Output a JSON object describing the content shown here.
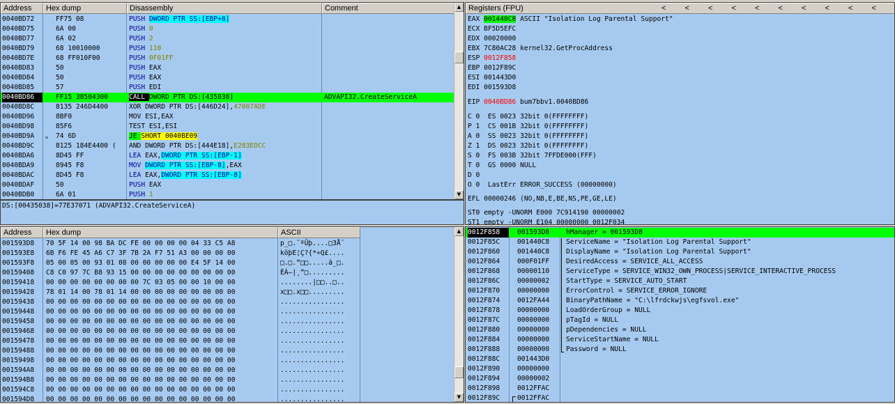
{
  "disasm": {
    "headers": {
      "address": "Address",
      "hex": "Hex dump",
      "disassembly": "Disassembly",
      "comment": "Comment"
    },
    "rows": [
      {
        "addr": "0040BD72",
        "hex": "FF75 08",
        "mn": "PUSH",
        "op": "DWORD PTR SS:[EBP+8]",
        "opstyle": "cyan",
        "comment": ""
      },
      {
        "addr": "0040BD75",
        "hex": "6A 00",
        "mn": "PUSH",
        "op": "0",
        "opstyle": "olive",
        "comment": ""
      },
      {
        "addr": "0040BD77",
        "hex": "6A 02",
        "mn": "PUSH",
        "op": "2",
        "opstyle": "olive",
        "comment": ""
      },
      {
        "addr": "0040BD79",
        "hex": "68 10010000",
        "mn": "PUSH",
        "op": "110",
        "opstyle": "olive",
        "comment": ""
      },
      {
        "addr": "0040BD7E",
        "hex": "68 FF010F00",
        "mn": "PUSH",
        "op": "0F01FF",
        "opstyle": "olive",
        "comment": ""
      },
      {
        "addr": "0040BD83",
        "hex": "50",
        "mn": "PUSH",
        "op": "EAX",
        "opstyle": "plain",
        "comment": ""
      },
      {
        "addr": "0040BD84",
        "hex": "50",
        "mn": "PUSH",
        "op": "EAX",
        "opstyle": "plain",
        "comment": ""
      },
      {
        "addr": "0040BD85",
        "hex": "57",
        "mn": "PUSH",
        "op": "EDI",
        "opstyle": "plain",
        "comment": ""
      },
      {
        "addr": "0040BD86",
        "hex": "FF15 38504300",
        "mn": "CALL",
        "op": "DWORD PTR DS:[435038]",
        "opstyle": "plain",
        "comment": "ADVAPI32.CreateServiceA",
        "selected": true
      },
      {
        "addr": "0040BD8C",
        "hex": "8135 246D4400 ",
        "mn": "XOR",
        "op": "DWORD PTR DS:[446D24],",
        "op2": "47007ADE",
        "opstyle": "plain",
        "comment": ""
      },
      {
        "addr": "0040BD96",
        "hex": "8BF0",
        "mn": "MOV",
        "op": "ESI,EAX",
        "opstyle": "plain",
        "comment": ""
      },
      {
        "addr": "0040BD98",
        "hex": "85F6",
        "mn": "TEST",
        "op": "ESI,ESI",
        "opstyle": "plain",
        "comment": ""
      },
      {
        "addr": "0040BD9A",
        "arrow": "⌄",
        "hex": "74 6D",
        "mn": "JE",
        "op": "SHORT 0040BE09",
        "opstyle": "yellow",
        "comment": ""
      },
      {
        "addr": "0040BD9C",
        "hex": "8125 184E4400 (",
        "mn": "AND",
        "op": "DWORD PTR DS:[444E18],",
        "op2": "E283EDCC",
        "opstyle": "plain",
        "comment": ""
      },
      {
        "addr": "0040BDA6",
        "hex": "8D45 FF",
        "mn": "LEA",
        "op": "EAX,",
        "op3": "DWORD PTR SS:[EBP-1]",
        "opstyle": "plain",
        "comment": ""
      },
      {
        "addr": "0040BDA9",
        "hex": "8945 F8",
        "mn": "MOV",
        "op": "DWORD PTR SS:[EBP-8]",
        "op4": ",EAX",
        "opstyle": "cyan",
        "comment": ""
      },
      {
        "addr": "0040BDAC",
        "hex": "8D45 F8",
        "mn": "LEA",
        "op": "EAX,",
        "op3": "DWORD PTR SS:[EBP-8]",
        "opstyle": "plain",
        "comment": ""
      },
      {
        "addr": "0040BDAF",
        "hex": "50",
        "mn": "PUSH",
        "op": "EAX",
        "opstyle": "plain",
        "comment": ""
      },
      {
        "addr": "0040BDB0",
        "hex": "6A 01",
        "mn": "PUSH",
        "op": "1",
        "opstyle": "olive",
        "comment": ""
      }
    ],
    "info": "DS:[00435038]=77E37071 (ADVAPI32.CreateServiceA)"
  },
  "registers": {
    "title": "Registers (FPU)",
    "arrows": [
      "<",
      "<",
      "<",
      "<",
      "<",
      "<",
      "<",
      "<",
      "<",
      "<"
    ],
    "gp": [
      {
        "name": "EAX",
        "val": "001440C8",
        "style": "green",
        "note": "ASCII \"Isolation Log Parental Support\""
      },
      {
        "name": "ECX",
        "val": "BF5D5EFC",
        "style": "",
        "note": ""
      },
      {
        "name": "EDX",
        "val": "00020000",
        "style": "",
        "note": ""
      },
      {
        "name": "EBX",
        "val": "7C80AC28",
        "style": "",
        "note": "kernel32.GetProcAddress"
      },
      {
        "name": "ESP",
        "val": "0012F858",
        "style": "red",
        "note": ""
      },
      {
        "name": "EBP",
        "val": "0012F89C",
        "style": "",
        "note": ""
      },
      {
        "name": "ESI",
        "val": "001443D0",
        "style": "",
        "note": ""
      },
      {
        "name": "EDI",
        "val": "001593D8",
        "style": "",
        "note": ""
      }
    ],
    "eip": {
      "name": "EIP",
      "val": "0040BD86",
      "note": "bum7bbv1.0040BD86"
    },
    "flags": [
      "C 0  ES 0023 32bit 0(FFFFFFFF)",
      "P 1  CS 001B 32bit 0(FFFFFFFF)",
      "A 0  SS 0023 32bit 0(FFFFFFFF)",
      "Z 1  DS 0023 32bit 0(FFFFFFFF)",
      "S 0  FS 003B 32bit 7FFDE000(FFF)",
      "T 0  GS 0000 NULL",
      "D 0",
      "O 0  LastErr ERROR_SUCCESS (00000000)"
    ],
    "efl": "EFL 00000246 (NO,NB,E,BE,NS,PE,GE,LE)",
    "st0": "ST0 empty -UNORM E000 7C914190 00000002",
    "st1": "ST1 empty -UNORM E104 00000000 0012F034"
  },
  "dump": {
    "headers": {
      "address": "Address",
      "hex": "Hex dump",
      "ascii": "ASCII"
    },
    "rows": [
      {
        "addr": "001593D8",
        "hex": "70 5F 14 00 98 BA DC FE 00 00 00 00 04 33 C5 A8",
        "ascii": "p_□.˜ºÜþ....□3Å¨"
      },
      {
        "addr": "001593E8",
        "hex": "6B F6 FE 45 A6 C7 3F 7B 2A F7 51 A3 00 00 00 00",
        "ascii": "köþE¦Ç?{*÷Q£...."
      },
      {
        "addr": "001593F8",
        "hex": "05 00 05 00 93 01 08 00 00 00 00 00 E4 5F 14 00",
        "ascii": "□.□.“□□.....ä_□."
      },
      {
        "addr": "00159408",
        "hex": "C8 C0 97 7C B8 93 15 00 00 00 00 00 00 00 00 00",
        "ascii": "ÈÀ—|¸“□........."
      },
      {
        "addr": "00159418",
        "hex": "00 00 00 00 00 00 00 00 7C 03 05 00 00 10 00 00",
        "ascii": "........|□□..□.."
      },
      {
        "addr": "00159428",
        "hex": "78 01 14 00 78 01 14 00 00 00 00 00 00 00 00 00",
        "ascii": "x□□.x□□........."
      },
      {
        "addr": "00159438",
        "hex": "00 00 00 00 00 00 00 00 00 00 00 00 00 00 00 00",
        "ascii": "................"
      },
      {
        "addr": "00159448",
        "hex": "00 00 00 00 00 00 00 00 00 00 00 00 00 00 00 00",
        "ascii": "................"
      },
      {
        "addr": "00159458",
        "hex": "00 00 00 00 00 00 00 00 00 00 00 00 00 00 00 00",
        "ascii": "................"
      },
      {
        "addr": "00159468",
        "hex": "00 00 00 00 00 00 00 00 00 00 00 00 00 00 00 00",
        "ascii": "................"
      },
      {
        "addr": "00159478",
        "hex": "00 00 00 00 00 00 00 00 00 00 00 00 00 00 00 00",
        "ascii": "................"
      },
      {
        "addr": "00159488",
        "hex": "00 00 00 00 00 00 00 00 00 00 00 00 00 00 00 00",
        "ascii": "................"
      },
      {
        "addr": "00159498",
        "hex": "00 00 00 00 00 00 00 00 00 00 00 00 00 00 00 00",
        "ascii": "................"
      },
      {
        "addr": "001594A8",
        "hex": "00 00 00 00 00 00 00 00 00 00 00 00 00 00 00 00",
        "ascii": "................"
      },
      {
        "addr": "001594B8",
        "hex": "00 00 00 00 00 00 00 00 00 00 00 00 00 00 00 00",
        "ascii": "................"
      },
      {
        "addr": "001594C8",
        "hex": "00 00 00 00 00 00 00 00 00 00 00 00 00 00 00 00",
        "ascii": "................"
      },
      {
        "addr": "001594D8",
        "hex": "00 00 00 00 00 00 00 00 00 00 00 00 00 00 00 00",
        "ascii": "................"
      }
    ]
  },
  "stack": {
    "rows": [
      {
        "addr": "0012F858",
        "val": "001593D8",
        "comment": "hManager = 001593D8",
        "selected": true
      },
      {
        "addr": "0012F85C",
        "val": "001440C8",
        "comment": "ServiceName = \"Isolation Log Parental Support\""
      },
      {
        "addr": "0012F860",
        "val": "001440C8",
        "comment": "DisplayName = \"Isolation Log Parental Support\""
      },
      {
        "addr": "0012F864",
        "val": "000F01FF",
        "comment": "DesiredAccess = SERVICE_ALL_ACCESS"
      },
      {
        "addr": "0012F868",
        "val": "00000110",
        "comment": "ServiceType = SERVICE_WIN32_OWN_PROCESS|SERVICE_INTERACTIVE_PROCESS"
      },
      {
        "addr": "0012F86C",
        "val": "00000002",
        "comment": "StartType = SERVICE_AUTO_START"
      },
      {
        "addr": "0012F870",
        "val": "00000000",
        "comment": "ErrorControl = SERVICE_ERROR_IGNORE"
      },
      {
        "addr": "0012F874",
        "val": "0012FA44",
        "comment": "BinaryPathName = \"C:\\lfrdckwjs\\egfsvol.exe\""
      },
      {
        "addr": "0012F878",
        "val": "00000000",
        "comment": "LoadOrderGroup = NULL"
      },
      {
        "addr": "0012F87C",
        "val": "00000000",
        "comment": "pTagId = NULL"
      },
      {
        "addr": "0012F880",
        "val": "00000000",
        "comment": "pDependencies = NULL"
      },
      {
        "addr": "0012F884",
        "val": "00000000",
        "comment": "ServiceStartName = NULL"
      },
      {
        "addr": "0012F888",
        "val": "00000000",
        "comment": "Password = NULL"
      },
      {
        "addr": "0012F88C",
        "val": "001443D0",
        "comment": ""
      },
      {
        "addr": "0012F890",
        "val": "00000000",
        "comment": ""
      },
      {
        "addr": "0012F894",
        "val": "00000002",
        "comment": ""
      },
      {
        "addr": "0012F898",
        "val": "0012FFAC",
        "comment": ""
      },
      {
        "addr": "0012F89C",
        "val": "0012FFAC",
        "comment": ""
      }
    ]
  },
  "scroll": {
    "up": "▲",
    "down": "▼"
  }
}
